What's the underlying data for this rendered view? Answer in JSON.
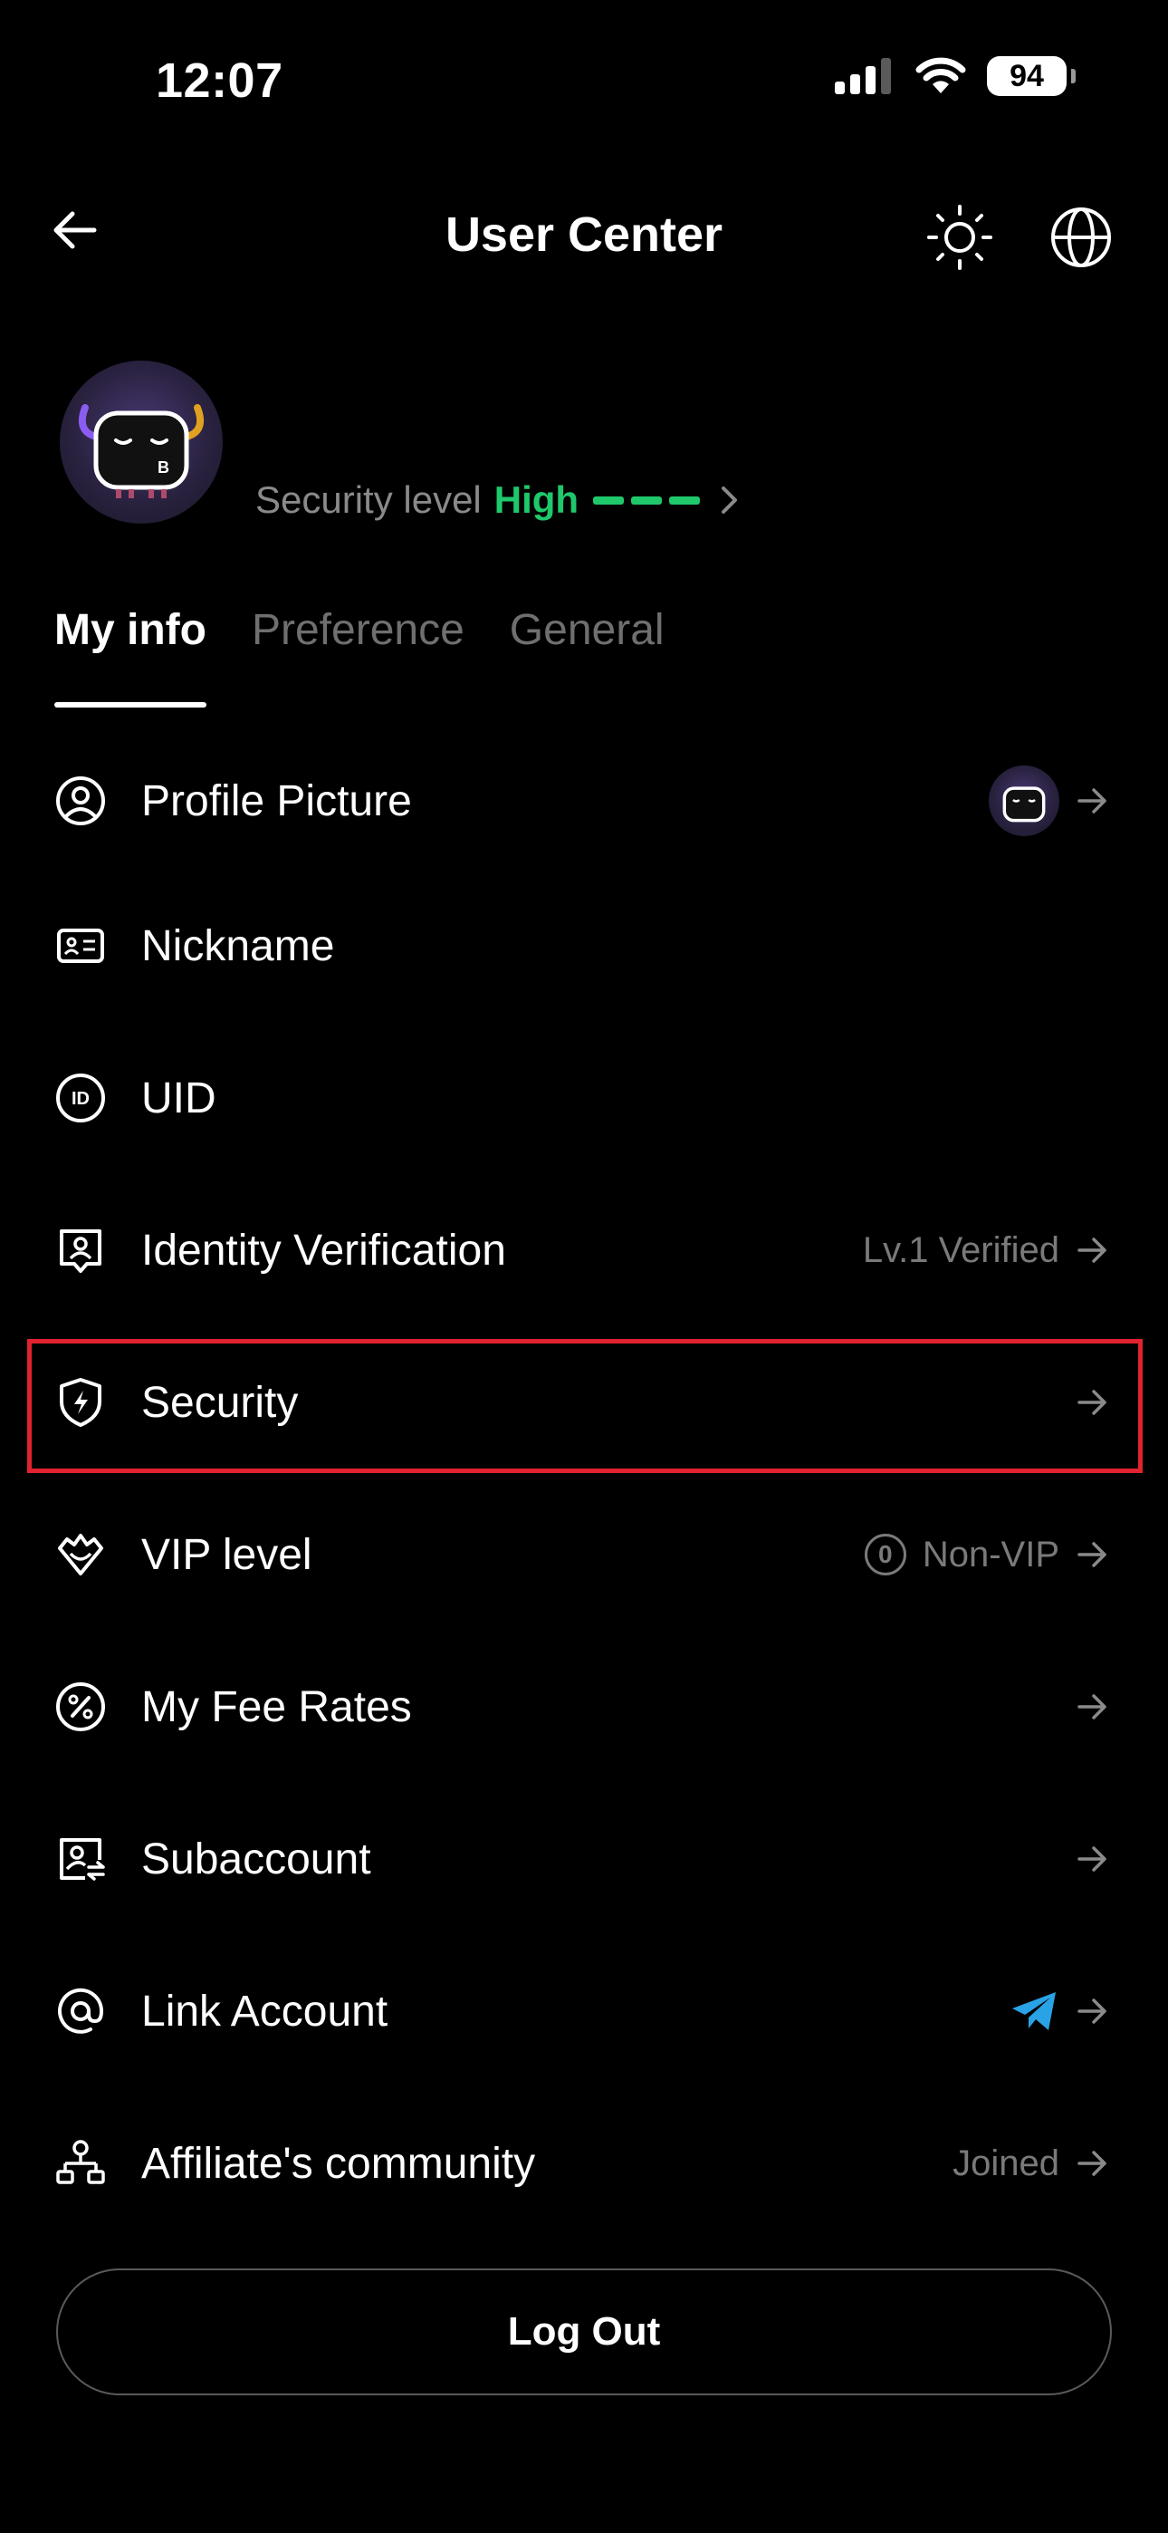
{
  "status_bar": {
    "time": "12:07",
    "battery": "94"
  },
  "header": {
    "title": "User Center",
    "back_icon": "arrow-left-icon",
    "theme_icon": "sun-icon",
    "language_icon": "globe-icon"
  },
  "profile": {
    "avatar_letter": "B",
    "security_label": "Security level",
    "security_value": "High",
    "security_color": "#1fc86b"
  },
  "tabs": [
    {
      "label": "My info",
      "active": true
    },
    {
      "label": "Preference",
      "active": false
    },
    {
      "label": "General",
      "active": false
    }
  ],
  "menu": [
    {
      "label": "Profile Picture",
      "icon": "user-circle-icon",
      "right_text": ""
    },
    {
      "label": "Nickname",
      "icon": "id-card-icon",
      "right_text": ""
    },
    {
      "label": "UID",
      "icon": "id-badge-icon",
      "right_text": ""
    },
    {
      "label": "Identity Verification",
      "icon": "identity-icon",
      "right_text": "Lv.1 Verified"
    },
    {
      "label": "Security",
      "icon": "shield-bolt-icon",
      "right_text": ""
    },
    {
      "label": "VIP level",
      "icon": "diamond-crown-icon",
      "right_text": "Non-VIP",
      "badge": "0"
    },
    {
      "label": "My Fee Rates",
      "icon": "percent-icon",
      "right_text": ""
    },
    {
      "label": "Subaccount",
      "icon": "subaccount-icon",
      "right_text": ""
    },
    {
      "label": "Link Account",
      "icon": "at-icon",
      "right_text": ""
    },
    {
      "label": "Affiliate's community",
      "icon": "network-icon",
      "right_text": "Joined"
    }
  ],
  "logout_label": "Log Out",
  "colors": {
    "accent_green": "#1fc86b",
    "highlight_red": "#e0232e",
    "telegram_blue": "#2aa3e6"
  }
}
